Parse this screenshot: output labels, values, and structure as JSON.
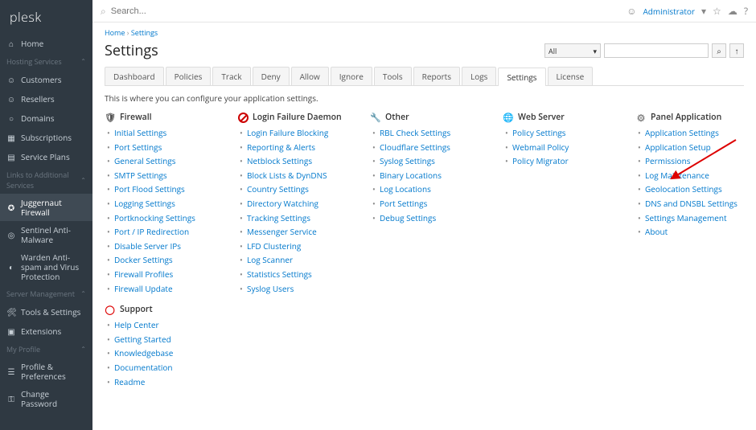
{
  "brand": "plesk",
  "search_placeholder": "Search...",
  "admin_label": "Administrator",
  "nav": {
    "home": "Home",
    "section_hosting": "Hosting Services",
    "customers": "Customers",
    "resellers": "Resellers",
    "domains": "Domains",
    "subscriptions": "Subscriptions",
    "service_plans": "Service Plans",
    "section_links": "Links to Additional Services",
    "juggernaut": "Juggernaut Firewall",
    "sentinel": "Sentinel Anti-Malware",
    "warden": "Warden Anti-spam and Virus Protection",
    "section_server": "Server Management",
    "tools": "Tools & Settings",
    "extensions": "Extensions",
    "section_profile": "My Profile",
    "profile_prefs": "Profile & Preferences",
    "change_pw": "Change Password"
  },
  "breadcrumb": {
    "home": "Home",
    "current": "Settings"
  },
  "page_title": "Settings",
  "filter_all": "All",
  "tabs": [
    "Dashboard",
    "Policies",
    "Track",
    "Deny",
    "Allow",
    "Ignore",
    "Tools",
    "Reports",
    "Logs",
    "Settings",
    "License"
  ],
  "active_tab": 9,
  "intro": "This is where you can configure your application settings.",
  "columns": {
    "firewall": {
      "title": "Firewall",
      "items": [
        "Initial Settings",
        "Port Settings",
        "General Settings",
        "SMTP Settings",
        "Port Flood Settings",
        "Logging Settings",
        "Portknocking Settings",
        "Port / IP Redirection",
        "Disable Server IPs",
        "Docker Settings",
        "Firewall Profiles",
        "Firewall Update"
      ]
    },
    "login": {
      "title": "Login Failure Daemon",
      "items": [
        "Login Failure Blocking",
        "Reporting & Alerts",
        "Netblock Settings",
        "Block Lists & DynDNS",
        "Country Settings",
        "Directory Watching",
        "Tracking Settings",
        "Messenger Service",
        "LFD Clustering",
        "Log Scanner",
        "Statistics Settings",
        "Syslog Users"
      ]
    },
    "other": {
      "title": "Other",
      "items": [
        "RBL Check Settings",
        "Cloudflare Settings",
        "Syslog Settings",
        "Binary Locations",
        "Log Locations",
        "Port Settings",
        "Debug Settings"
      ]
    },
    "web": {
      "title": "Web Server",
      "items": [
        "Policy Settings",
        "Webmail Policy",
        "Policy Migrator"
      ]
    },
    "panel": {
      "title": "Panel Application",
      "items": [
        "Application Settings",
        "Application Setup",
        "Permissions",
        "Log Maintenance",
        "Geolocation Settings",
        "DNS and DNSBL Settings",
        "Settings Management",
        "About"
      ]
    },
    "support": {
      "title": "Support",
      "items": [
        "Help Center",
        "Getting Started",
        "Knowledgebase",
        "Documentation",
        "Readme"
      ]
    }
  }
}
